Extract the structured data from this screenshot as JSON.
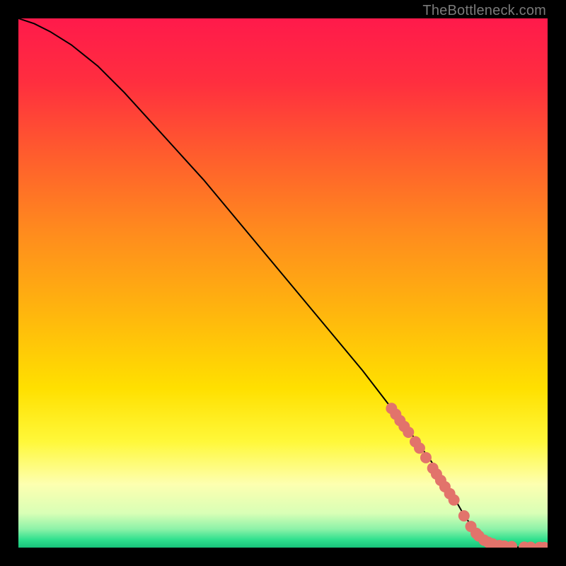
{
  "watermark": "TheBottleneck.com",
  "chart_data": {
    "type": "line",
    "title": "",
    "xlabel": "",
    "ylabel": "",
    "xlim": [
      0,
      100
    ],
    "ylim": [
      0,
      100
    ],
    "curve": {
      "x": [
        0,
        3,
        6,
        10,
        15,
        20,
        25,
        30,
        35,
        40,
        45,
        50,
        55,
        60,
        65,
        70,
        75,
        80,
        84,
        86,
        88,
        90,
        92,
        94,
        96,
        98,
        100
      ],
      "y": [
        100,
        99,
        97.5,
        95,
        91,
        86,
        80.5,
        75,
        69.5,
        63.5,
        57.5,
        51.5,
        45.5,
        39.5,
        33.5,
        27,
        20.5,
        13.5,
        6.5,
        3.5,
        1.5,
        0.6,
        0.25,
        0.1,
        0.05,
        0.02,
        0.01
      ]
    },
    "markers": {
      "x": [
        70.5,
        71.3,
        72.1,
        72.9,
        73.7,
        75.0,
        75.8,
        77.0,
        78.3,
        79.0,
        79.8,
        80.6,
        81.5,
        82.3,
        84.2,
        85.5,
        86.5,
        87.0,
        88.0,
        88.8,
        89.6,
        90.9,
        91.8,
        93.2,
        95.6,
        96.8,
        98.5,
        99.4
      ],
      "y": [
        26.3,
        25.2,
        24.0,
        22.9,
        21.8,
        20.0,
        18.8,
        17.0,
        15.0,
        13.9,
        12.7,
        11.5,
        10.2,
        9.0,
        6.0,
        4.0,
        2.7,
        2.2,
        1.4,
        1.0,
        0.7,
        0.4,
        0.3,
        0.2,
        0.08,
        0.06,
        0.03,
        0.02
      ]
    },
    "background_gradient": {
      "stops": [
        {
          "pos": 0.0,
          "color": "#ff1a4b"
        },
        {
          "pos": 0.12,
          "color": "#ff2e3f"
        },
        {
          "pos": 0.25,
          "color": "#ff5a2e"
        },
        {
          "pos": 0.4,
          "color": "#ff8a1e"
        },
        {
          "pos": 0.55,
          "color": "#ffb40e"
        },
        {
          "pos": 0.7,
          "color": "#ffe000"
        },
        {
          "pos": 0.8,
          "color": "#fff83a"
        },
        {
          "pos": 0.88,
          "color": "#fdffb0"
        },
        {
          "pos": 0.935,
          "color": "#d9ffb6"
        },
        {
          "pos": 0.965,
          "color": "#8cf2a8"
        },
        {
          "pos": 0.985,
          "color": "#2fe08e"
        },
        {
          "pos": 1.0,
          "color": "#18c27a"
        }
      ]
    },
    "curve_color": "#000000",
    "marker_color": "#e2736b",
    "marker_radius": 8
  }
}
